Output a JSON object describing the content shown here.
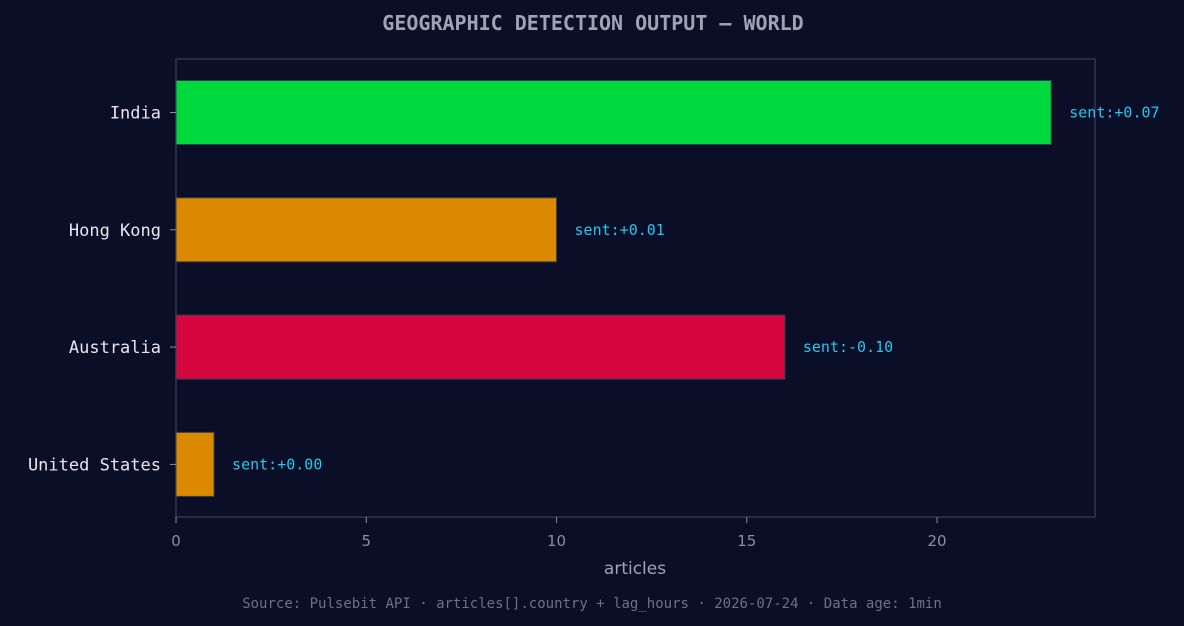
{
  "chart_data": {
    "type": "bar",
    "orientation": "horizontal",
    "title": "GEOGRAPHIC DETECTION OUTPUT — WORLD",
    "xlabel": "articles",
    "ylabel": "",
    "xlim": [
      0,
      24.15
    ],
    "xticks": [
      0,
      5,
      10,
      15,
      20
    ],
    "grid": false,
    "categories": [
      "India",
      "Hong Kong",
      "Australia",
      "United States"
    ],
    "values": [
      23,
      10,
      16,
      1
    ],
    "bar_colors": [
      "#00d93d",
      "#db8a00",
      "#d6073e",
      "#db8a00"
    ],
    "annotations": [
      "sent:+0.07",
      "sent:+0.01",
      "sent:-0.10",
      "sent:+0.00"
    ],
    "annotation_color": "#22c8f0",
    "footer": "Source: Pulsebit API · articles[].country + lag_hours · 2026-07-24 · Data age: 1min"
  },
  "colors": {
    "background": "#0b0e27",
    "frame": "#33364f"
  }
}
